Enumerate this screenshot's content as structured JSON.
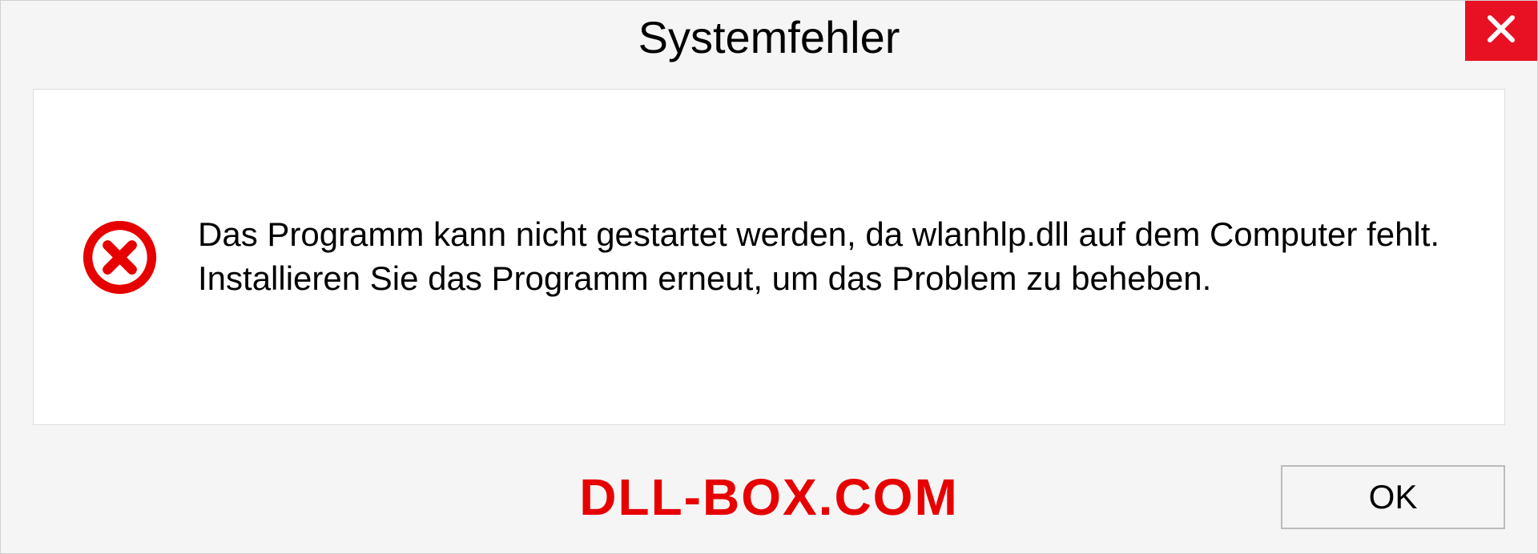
{
  "dialog": {
    "title": "Systemfehler",
    "message": "Das Programm kann nicht gestartet werden, da wlanhlp.dll auf dem Computer fehlt. Installieren Sie das Programm erneut, um das Problem zu beheben.",
    "ok_label": "OK",
    "watermark": "DLL-BOX.COM"
  }
}
